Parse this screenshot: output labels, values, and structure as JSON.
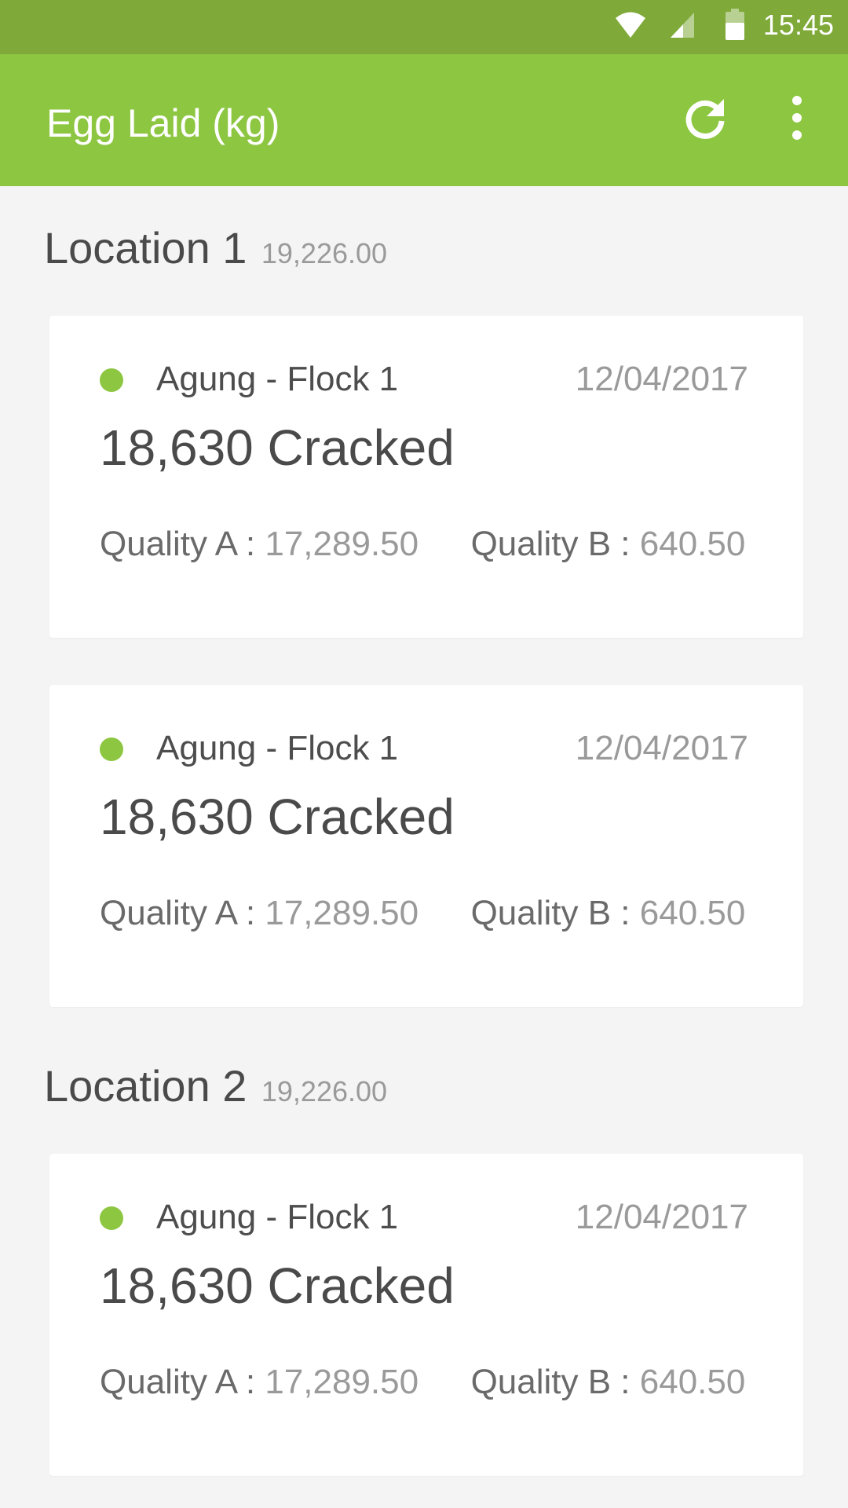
{
  "status_bar": {
    "time": "15:45",
    "icons": [
      "wifi-icon",
      "cell-signal-icon",
      "battery-icon"
    ]
  },
  "app_bar": {
    "title": "Egg Laid (kg)",
    "actions": [
      "refresh-icon",
      "more-vert-icon"
    ],
    "color": "#8dc641"
  },
  "sections": [
    {
      "title": "Location 1",
      "total": "19,226.00",
      "cards": [
        {
          "flock": "Agung - Flock 1",
          "date": "12/04/2017",
          "amount": "18,630 Cracked",
          "quality_a_label": "Quality A :",
          "quality_a_value": "17,289.50",
          "quality_b_label": "Quality B :",
          "quality_b_value": "640.50"
        },
        {
          "flock": "Agung - Flock 1",
          "date": "12/04/2017",
          "amount": "18,630 Cracked",
          "quality_a_label": "Quality A :",
          "quality_a_value": "17,289.50",
          "quality_b_label": "Quality B :",
          "quality_b_value": "640.50"
        }
      ]
    },
    {
      "title": "Location 2",
      "total": "19,226.00",
      "cards": [
        {
          "flock": "Agung - Flock 1",
          "date": "12/04/2017",
          "amount": "18,630 Cracked",
          "quality_a_label": "Quality A :",
          "quality_a_value": "17,289.50",
          "quality_b_label": "Quality B :",
          "quality_b_value": "640.50"
        }
      ]
    }
  ]
}
